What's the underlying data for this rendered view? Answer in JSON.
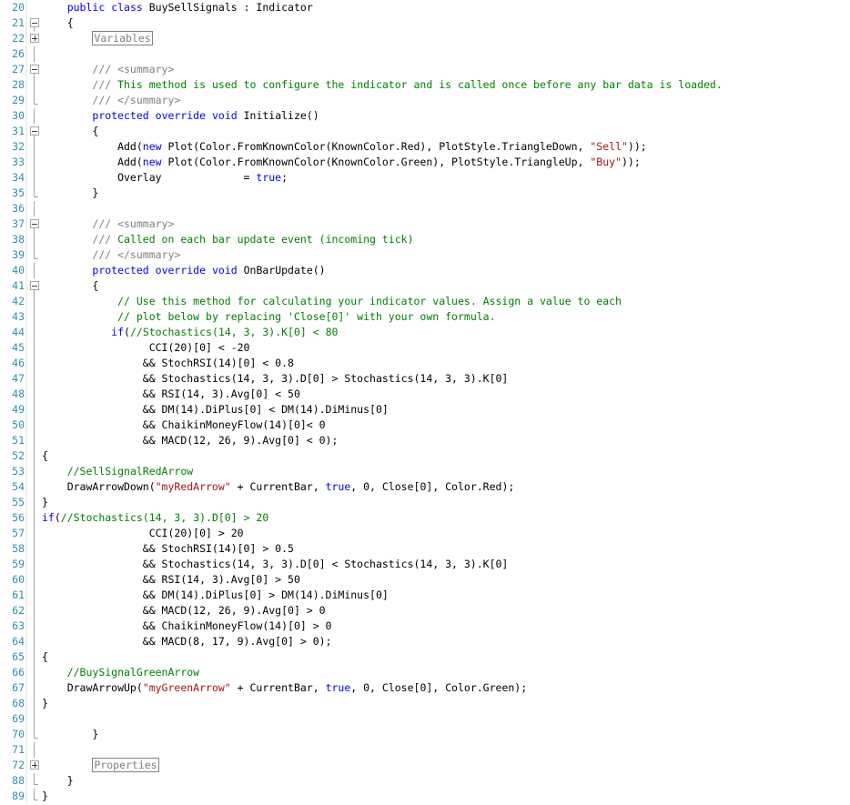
{
  "editor": {
    "colors": {
      "keyword": "#0000ff",
      "comment": "#008000",
      "xml_doc": "#808080",
      "string": "#a31515",
      "line_number": "#2b91af",
      "text": "#000000"
    },
    "lines": [
      {
        "n": "20",
        "fold": "none",
        "text": "    public class BuySellSignals : Indicator"
      },
      {
        "n": "21",
        "fold": "minus",
        "text": "    {"
      },
      {
        "n": "22",
        "fold": "plus",
        "text": "        Variables"
      },
      {
        "n": "26",
        "fold": "line",
        "text": ""
      },
      {
        "n": "27",
        "fold": "minus",
        "text": "        /// <summary>"
      },
      {
        "n": "28",
        "fold": "line",
        "text": "        /// This method is used to configure the indicator and is called once before any bar data is loaded."
      },
      {
        "n": "29",
        "fold": "end",
        "text": "        /// </summary>"
      },
      {
        "n": "30",
        "fold": "line",
        "text": "        protected override void Initialize()"
      },
      {
        "n": "31",
        "fold": "minus",
        "text": "        {"
      },
      {
        "n": "32",
        "fold": "line",
        "text": "            Add(new Plot(Color.FromKnownColor(KnownColor.Red), PlotStyle.TriangleDown, \"Sell\"));"
      },
      {
        "n": "33",
        "fold": "line",
        "text": "            Add(new Plot(Color.FromKnownColor(KnownColor.Green), PlotStyle.TriangleUp, \"Buy\"));"
      },
      {
        "n": "34",
        "fold": "line",
        "text": "            Overlay             = true;"
      },
      {
        "n": "35",
        "fold": "end",
        "text": "        }"
      },
      {
        "n": "36",
        "fold": "line",
        "text": ""
      },
      {
        "n": "37",
        "fold": "minus",
        "text": "        /// <summary>"
      },
      {
        "n": "38",
        "fold": "line",
        "text": "        /// Called on each bar update event (incoming tick)"
      },
      {
        "n": "39",
        "fold": "end",
        "text": "        /// </summary>"
      },
      {
        "n": "40",
        "fold": "line",
        "text": "        protected override void OnBarUpdate()"
      },
      {
        "n": "41",
        "fold": "minus",
        "text": "        {"
      },
      {
        "n": "42",
        "fold": "line",
        "text": "            // Use this method for calculating your indicator values. Assign a value to each"
      },
      {
        "n": "43",
        "fold": "line",
        "text": "            // plot below by replacing 'Close[0]' with your own formula."
      },
      {
        "n": "44",
        "fold": "line",
        "text": "           if(//Stochastics(14, 3, 3).K[0] < 80"
      },
      {
        "n": "45",
        "fold": "line",
        "text": "                 CCI(20)[0] < -20"
      },
      {
        "n": "46",
        "fold": "line",
        "text": "                && StochRSI(14)[0] < 0.8"
      },
      {
        "n": "47",
        "fold": "line",
        "text": "                && Stochastics(14, 3, 3).D[0] > Stochastics(14, 3, 3).K[0]"
      },
      {
        "n": "48",
        "fold": "line",
        "text": "                && RSI(14, 3).Avg[0] < 50"
      },
      {
        "n": "49",
        "fold": "line",
        "text": "                && DM(14).DiPlus[0] < DM(14).DiMinus[0]"
      },
      {
        "n": "50",
        "fold": "line",
        "text": "                && ChaikinMoneyFlow(14)[0]< 0"
      },
      {
        "n": "51",
        "fold": "line",
        "text": "                && MACD(12, 26, 9).Avg[0] < 0);"
      },
      {
        "n": "52",
        "fold": "line",
        "text": "{"
      },
      {
        "n": "53",
        "fold": "line",
        "text": "    //SellSignalRedArrow"
      },
      {
        "n": "54",
        "fold": "line",
        "text": "    DrawArrowDown(\"myRedArrow\" + CurrentBar, true, 0, Close[0], Color.Red);"
      },
      {
        "n": "55",
        "fold": "line",
        "text": "}"
      },
      {
        "n": "56",
        "fold": "line",
        "text": "if(//Stochastics(14, 3, 3).D[0] > 20"
      },
      {
        "n": "57",
        "fold": "line",
        "text": "                 CCI(20)[0] > 20"
      },
      {
        "n": "58",
        "fold": "line",
        "text": "                && StochRSI(14)[0] > 0.5"
      },
      {
        "n": "59",
        "fold": "line",
        "text": "                && Stochastics(14, 3, 3).D[0] < Stochastics(14, 3, 3).K[0]"
      },
      {
        "n": "60",
        "fold": "line",
        "text": "                && RSI(14, 3).Avg[0] > 50"
      },
      {
        "n": "61",
        "fold": "line",
        "text": "                && DM(14).DiPlus[0] > DM(14).DiMinus[0]"
      },
      {
        "n": "62",
        "fold": "line",
        "text": "                && MACD(12, 26, 9).Avg[0] > 0"
      },
      {
        "n": "63",
        "fold": "line",
        "text": "                && ChaikinMoneyFlow(14)[0] > 0"
      },
      {
        "n": "64",
        "fold": "line",
        "text": "                && MACD(8, 17, 9).Avg[0] > 0);"
      },
      {
        "n": "65",
        "fold": "line",
        "text": "{"
      },
      {
        "n": "66",
        "fold": "line",
        "text": "    //BuySignalGreenArrow"
      },
      {
        "n": "67",
        "fold": "line",
        "text": "    DrawArrowUp(\"myGreenArrow\" + CurrentBar, true, 0, Close[0], Color.Green);"
      },
      {
        "n": "68",
        "fold": "line",
        "text": "}"
      },
      {
        "n": "69",
        "fold": "line",
        "text": ""
      },
      {
        "n": "70",
        "fold": "end",
        "text": "        }"
      },
      {
        "n": "71",
        "fold": "line",
        "text": ""
      },
      {
        "n": "72",
        "fold": "plus",
        "text": "        Properties"
      },
      {
        "n": "88",
        "fold": "end",
        "text": "    }"
      },
      {
        "n": "89",
        "fold": "end",
        "text": "}"
      }
    ]
  }
}
